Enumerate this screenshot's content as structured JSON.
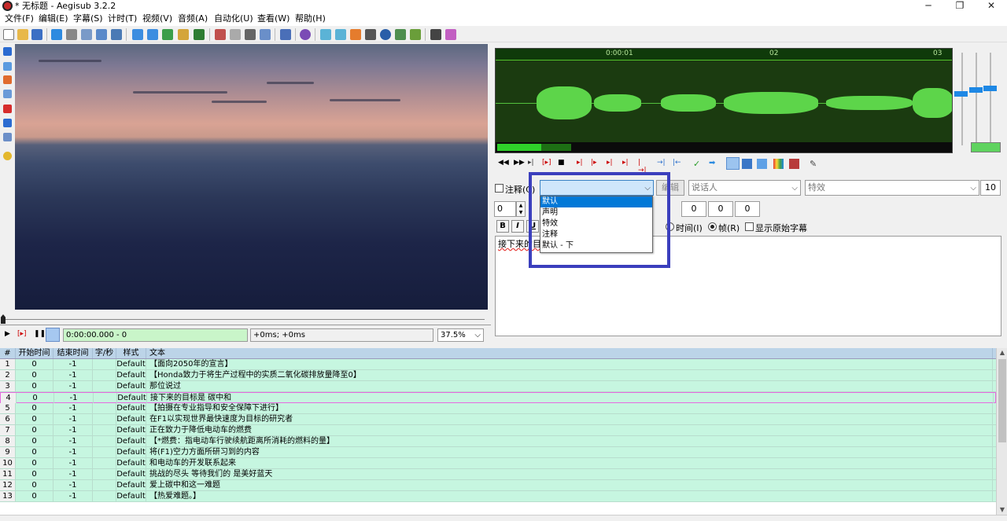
{
  "window": {
    "title": "* 无标题 - Aegisub 3.2.2",
    "minimize": "─",
    "maximize": "❐",
    "close": "✕"
  },
  "menu": [
    "文件(F)",
    "编辑(E)",
    "字幕(S)",
    "计时(T)",
    "视频(V)",
    "音频(A)",
    "自动化(U)",
    "查看(W)",
    "帮助(H)"
  ],
  "video": {
    "time": "0:00:00.000 - 0",
    "offset": "+0ms; +0ms",
    "zoom": "37.5%",
    "zoom_arrow": "⌵"
  },
  "audio": {
    "ticks": [
      "0:00:01",
      "02",
      "03"
    ]
  },
  "edit": {
    "comment_label": "注释(C)",
    "style_value": "",
    "edit_label": "编辑",
    "actor_placeholder": "说话人",
    "effect_placeholder": "特效",
    "layer": "10",
    "margin_l": "0",
    "margin_r": "0",
    "margin_v": "0",
    "margin_extra": "0",
    "time_radio": "时间(I)",
    "frame_radio": "帧(R)",
    "show_original": "显示原始字幕",
    "bold": "B",
    "italic": "I",
    "underline": "U",
    "text": "接下来的目"
  },
  "style_dropdown": {
    "options": [
      "默认",
      "声明",
      "特效",
      "注释",
      "默认 - 下"
    ],
    "selected_index": 0
  },
  "grid": {
    "headers": [
      "#",
      "开始时间",
      "结束时间",
      "字/秒",
      "样式",
      "文本"
    ],
    "rows": [
      [
        "1",
        "0",
        "-1",
        "",
        "Default",
        "【面向2050年的宣言】"
      ],
      [
        "2",
        "0",
        "-1",
        "",
        "Default",
        "【Honda致力于将生产过程中的实质二氧化碳排放量降至0】"
      ],
      [
        "3",
        "0",
        "-1",
        "",
        "Default",
        "那位说过"
      ],
      [
        "4",
        "0",
        "-1",
        "",
        "Default",
        "接下来的目标是 碳中和"
      ],
      [
        "5",
        "0",
        "-1",
        "",
        "Default",
        "【拍摄在专业指导和安全保障下进行】"
      ],
      [
        "6",
        "0",
        "-1",
        "",
        "Default",
        "在F1以实现世界最快速度为目标的研究者"
      ],
      [
        "7",
        "0",
        "-1",
        "",
        "Default",
        "正在致力于降低电动车的燃费"
      ],
      [
        "8",
        "0",
        "-1",
        "",
        "Default",
        "【*燃费：指电动车行驶续航距离所消耗的燃料的量】"
      ],
      [
        "9",
        "0",
        "-1",
        "",
        "Default",
        "将(F1)空力方面所研习到的内容"
      ],
      [
        "10",
        "0",
        "-1",
        "",
        "Default",
        "和电动车的开发联系起来"
      ],
      [
        "11",
        "0",
        "-1",
        "",
        "Default",
        "挑战的尽头 等待我们的 是美好蓝天"
      ],
      [
        "12",
        "0",
        "-1",
        "",
        "Default",
        "爱上碳中和这一难题"
      ],
      [
        "13",
        "0",
        "-1",
        "",
        "Default",
        "【热爱难题。】"
      ]
    ],
    "active_row": 3
  },
  "colors": {
    "accent": "#0078d7",
    "highlight_box": "#3b3fbd",
    "grid_row": "#c6f6e0",
    "waveform": "#5dd54a"
  }
}
